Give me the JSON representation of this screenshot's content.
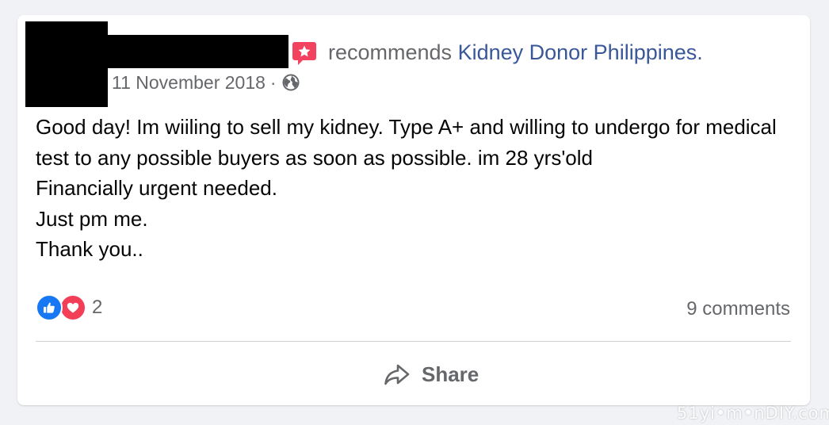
{
  "post": {
    "action_text": "recommends",
    "page_name": "Kidney Donor Philippines",
    "page_name_suffix": ".",
    "date": "11 November 2018",
    "date_separator": "·",
    "privacy_icon": "globe-icon",
    "recommend_icon": "recommend-star-icon",
    "body_lines": [
      "Good day! Im wiiling to sell my kidney. Type A+ and willing to undergo for medical test to any possible buyers as soon as possible. im 28 yrs'old",
      "Financially urgent needed.",
      "Just pm me.",
      "Thank you.."
    ]
  },
  "footer": {
    "reaction_icons": [
      "like-icon",
      "love-icon"
    ],
    "reaction_count": "2",
    "comments_count": "9 comments",
    "share_label": "Share",
    "share_icon": "share-arrow-icon"
  },
  "watermark": {
    "text": "51yi•m•nDIY.com"
  },
  "colors": {
    "background": "#f0f2f5",
    "card": "#ffffff",
    "link": "#385898",
    "secondary_text": "#65676b",
    "like_blue": "#1877f2",
    "love_red": "#f33e58",
    "recommend_pink": "#f3425f"
  }
}
